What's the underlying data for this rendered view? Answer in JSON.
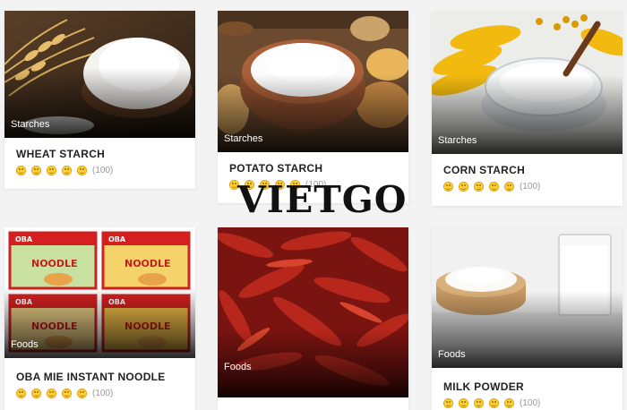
{
  "watermark": "VIETGO",
  "products": [
    {
      "name": "WHEAT STARCH",
      "category": "Starches",
      "rating_count": "(100)",
      "rating": 5
    },
    {
      "name": "POTATO STARCH",
      "category": "Starches",
      "rating_count": "(100)",
      "rating": 5
    },
    {
      "name": "CORN STARCH",
      "category": "Starches",
      "rating_count": "(100)",
      "rating": 5
    },
    {
      "name": "OBA MIE INSTANT NOODLE",
      "category": "Foods",
      "rating_count": "(100)",
      "rating": 5
    },
    {
      "name": "",
      "category": "Foods",
      "rating_count": "",
      "rating": 0
    },
    {
      "name": "MILK POWDER",
      "category": "Foods",
      "rating_count": "(100)",
      "rating": 5
    }
  ],
  "noodle_pack": {
    "brand": "OBA",
    "product": "NOODLE",
    "flavor": "INSTANT NOODLE"
  }
}
